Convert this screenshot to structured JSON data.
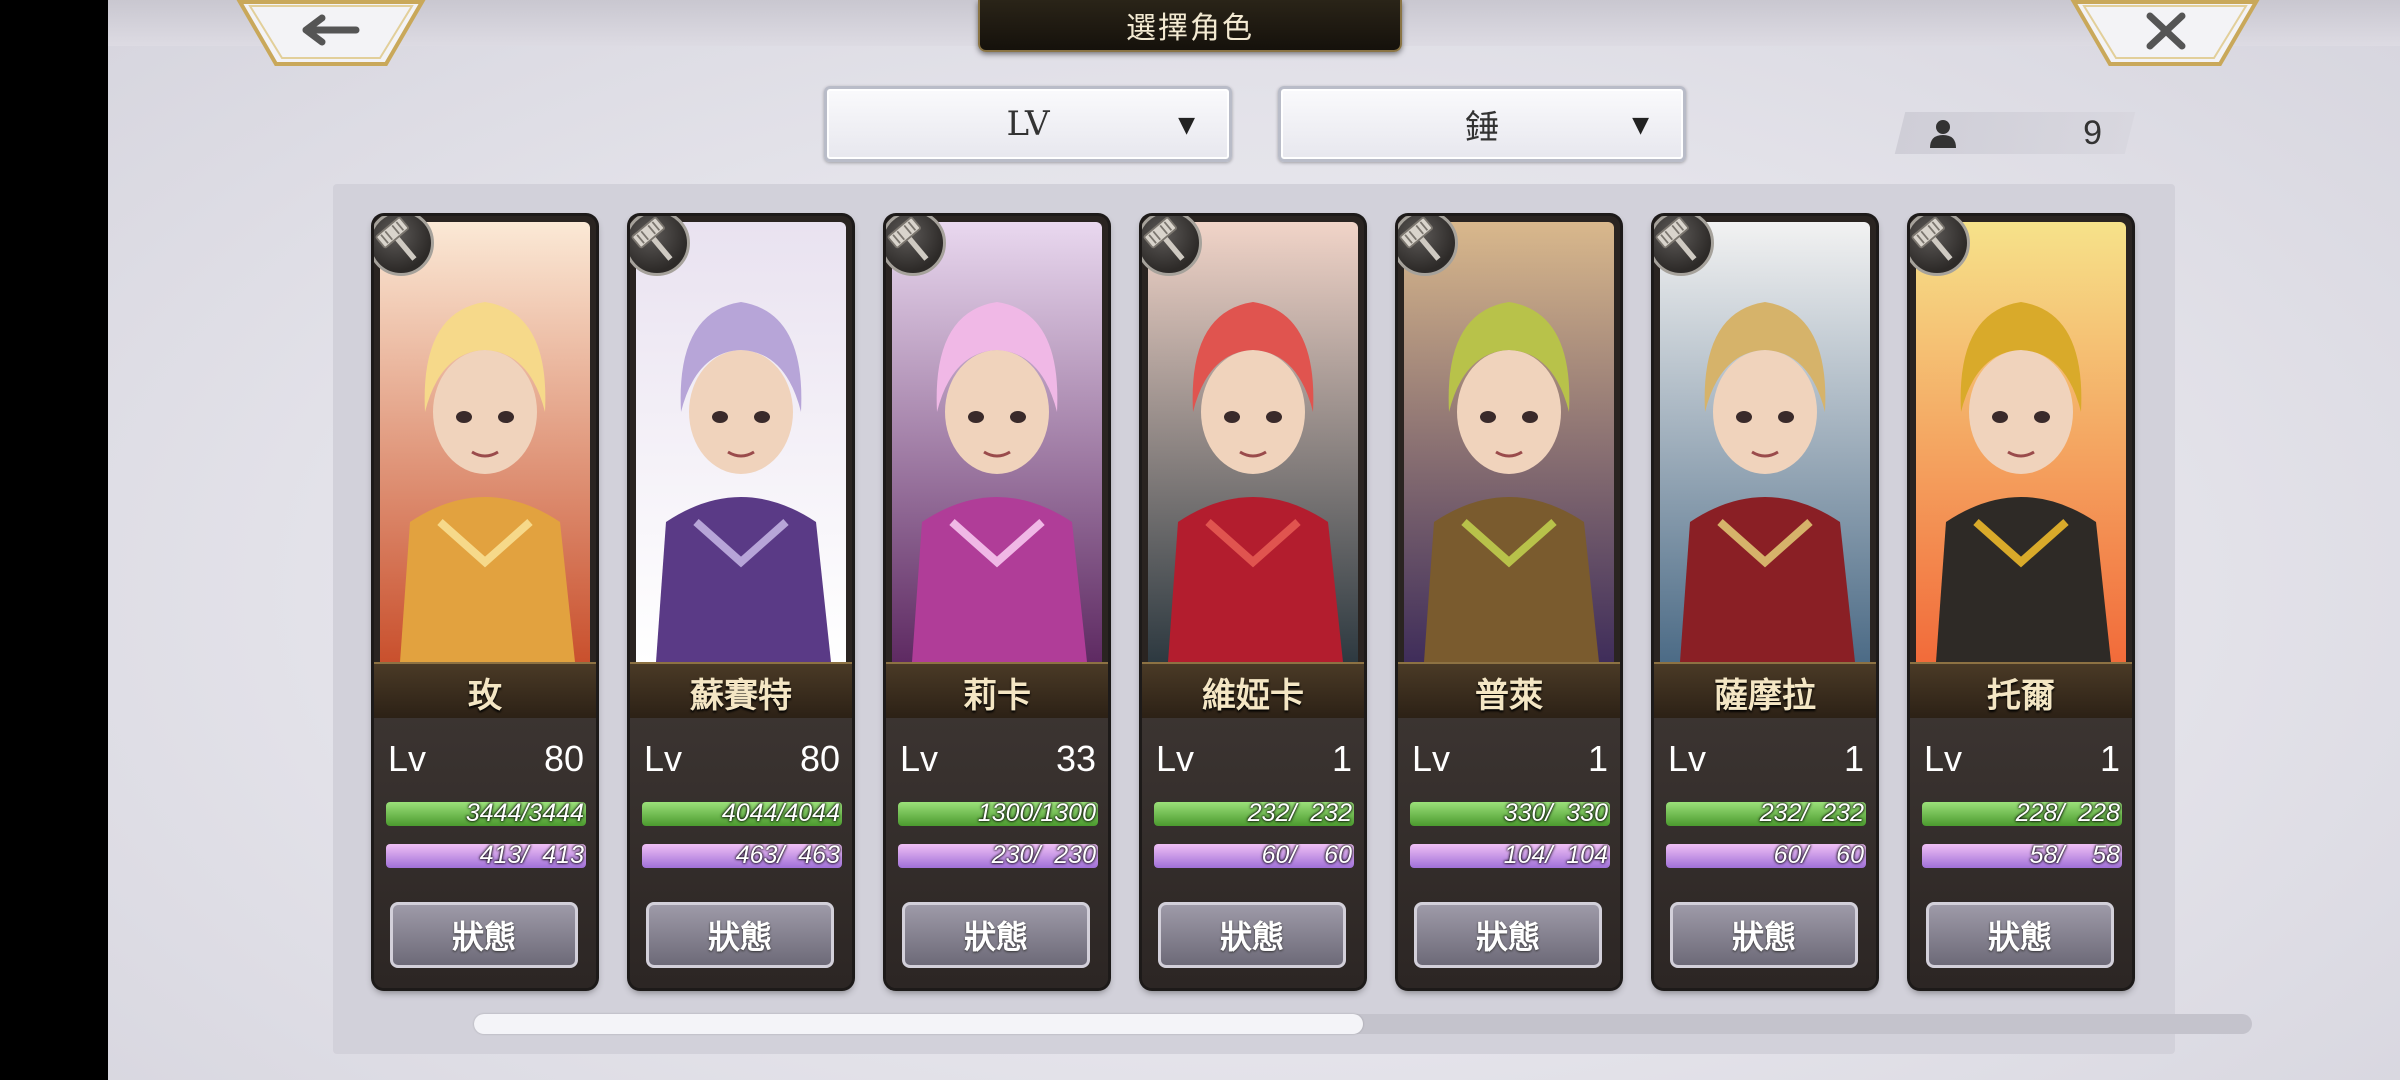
{
  "header": {
    "title": "選擇角色",
    "back_icon": "arrow-left-icon",
    "close_icon": "close-icon"
  },
  "filters": {
    "sort": "LV",
    "weapon": "錘"
  },
  "party_count": "9",
  "characters": [
    {
      "name": "玫",
      "lv_label": "Lv",
      "lv": "80",
      "hp": "3444/3444",
      "mp": " 413/  413",
      "hp_pct": 1,
      "mp_pct": 1,
      "status": "狀態",
      "palette": [
        "#f6d98a",
        "#e2a23f",
        "#c9502d",
        "#fbe9d6"
      ]
    },
    {
      "name": "蘇賽特",
      "lv_label": "Lv",
      "lv": "80",
      "hp": "4044/4044",
      "mp": " 463/  463",
      "hp_pct": 1,
      "mp_pct": 1,
      "status": "狀態",
      "palette": [
        "#b7a5d8",
        "#5a3a86",
        "#ffffff",
        "#e9e2f0"
      ]
    },
    {
      "name": "莉卡",
      "lv_label": "Lv",
      "lv": "33",
      "hp": "1300/1300",
      "mp": " 230/  230",
      "hp_pct": 1,
      "mp_pct": 1,
      "status": "狀態",
      "palette": [
        "#f0b8e6",
        "#b03d98",
        "#5e2a62",
        "#e9d8ef"
      ]
    },
    {
      "name": "維婭卡",
      "lv_label": "Lv",
      "lv": "1",
      "hp": "232/  232",
      "mp": "60/    60",
      "hp_pct": 1,
      "mp_pct": 1,
      "status": "狀態",
      "palette": [
        "#e0544f",
        "#b31d2e",
        "#2d3940",
        "#f1d4c8"
      ]
    },
    {
      "name": "普萊",
      "lv_label": "Lv",
      "lv": "1",
      "hp": "330/  330",
      "mp": "104/  104",
      "hp_pct": 1,
      "mp_pct": 1,
      "status": "狀態",
      "palette": [
        "#b8c24a",
        "#7a5b2e",
        "#3f2d5a",
        "#d9b88c"
      ]
    },
    {
      "name": "薩摩拉",
      "lv_label": "Lv",
      "lv": "1",
      "hp": "232/  232",
      "mp": "60/    60",
      "hp_pct": 1,
      "mp_pct": 1,
      "status": "狀態",
      "palette": [
        "#d6b36a",
        "#8a1f25",
        "#4c6b86",
        "#f2f2f2"
      ]
    },
    {
      "name": "托爾",
      "lv_label": "Lv",
      "lv": "1",
      "hp": "228/  228",
      "mp": "58/    58",
      "hp_pct": 1,
      "mp_pct": 1,
      "status": "狀態",
      "palette": [
        "#d9aa2a",
        "#2e2a26",
        "#f26b3a",
        "#f6e28a"
      ]
    }
  ],
  "scroll_position": 0.5
}
